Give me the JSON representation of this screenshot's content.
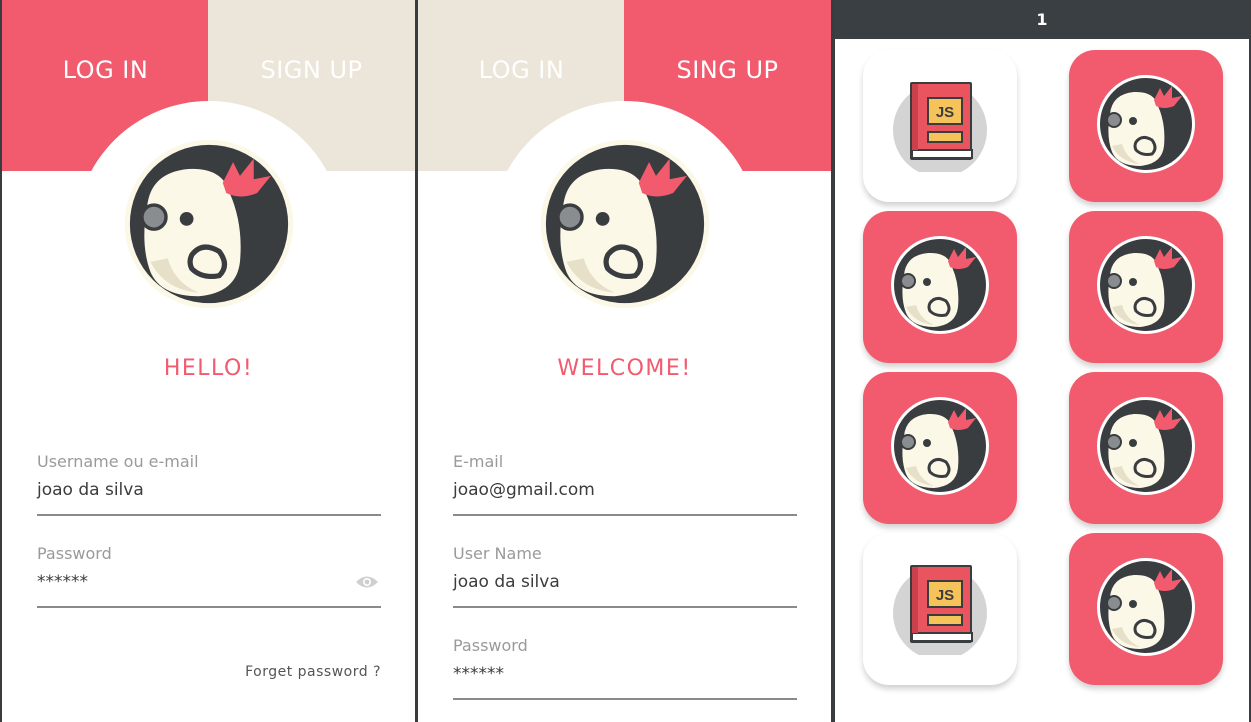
{
  "login_screen": {
    "tabs": [
      {
        "label": "LOG IN",
        "active": true
      },
      {
        "label": "SIGN UP",
        "active": false
      }
    ],
    "greeting": "HELLO!",
    "fields": [
      {
        "label": "Username ou e-mail",
        "value": "joao da silva"
      },
      {
        "label": "Password",
        "value": "******",
        "has_visibility_toggle": true
      }
    ],
    "forget_password": "Forget password ?"
  },
  "signup_screen": {
    "tabs": [
      {
        "label": "LOG IN",
        "active": false
      },
      {
        "label": "SING UP",
        "active": true
      }
    ],
    "greeting": "WELCOME!",
    "fields": [
      {
        "label": "E-mail",
        "value": "joao@gmail.com"
      },
      {
        "label": "User Name",
        "value": "joao da silva"
      },
      {
        "label": "Password",
        "value": "******"
      }
    ]
  },
  "game_board": {
    "header": "1",
    "cards": [
      {
        "face": "js-book-icon",
        "revealed": true
      },
      {
        "face": "penguin-avatar-icon",
        "revealed": false
      },
      {
        "face": "penguin-avatar-icon",
        "revealed": false
      },
      {
        "face": "penguin-avatar-icon",
        "revealed": false
      },
      {
        "face": "penguin-avatar-icon",
        "revealed": false
      },
      {
        "face": "penguin-avatar-icon",
        "revealed": false
      },
      {
        "face": "js-book-icon",
        "revealed": true
      },
      {
        "face": "penguin-avatar-icon",
        "revealed": false
      }
    ],
    "book_label": "JS"
  },
  "colors": {
    "accent": "#f25a6e",
    "inactive_tab": "#ebe6d9",
    "header_bar": "#3a3f43",
    "avatar_dark": "#3a3d40",
    "avatar_face": "#fcf8e8"
  }
}
